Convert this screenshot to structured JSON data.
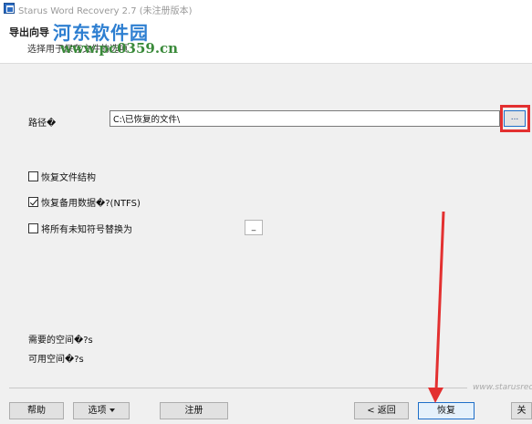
{
  "window": {
    "title": "Starus Word Recovery 2.7 (未注册版本)"
  },
  "header": {
    "title": "导出向导",
    "subtitle": "选择用于保存文件的选项",
    "watermark": {
      "logo": "河东软件园",
      "url": "www.pc0359.cn"
    }
  },
  "form": {
    "path_label": "路径�",
    "path_value": "C:\\已恢复的文件\\",
    "browse_label": "...",
    "options": [
      {
        "label": "恢复文件结构",
        "checked": false
      },
      {
        "label": "恢复备用数据�?(NTFS)",
        "checked": true
      },
      {
        "label": "将所有未知符号替换为",
        "checked": false
      }
    ],
    "replace_char": "_",
    "space_needed_label": "需要的空间�?s",
    "space_available_label": "可用空间�?s"
  },
  "footer": {
    "site": "www.starusrec",
    "buttons": {
      "help": "帮助",
      "options": "选项",
      "register": "注册",
      "back": "< 返回",
      "recover": "恢复",
      "close": "关"
    }
  },
  "annotation_color": "#e33030"
}
